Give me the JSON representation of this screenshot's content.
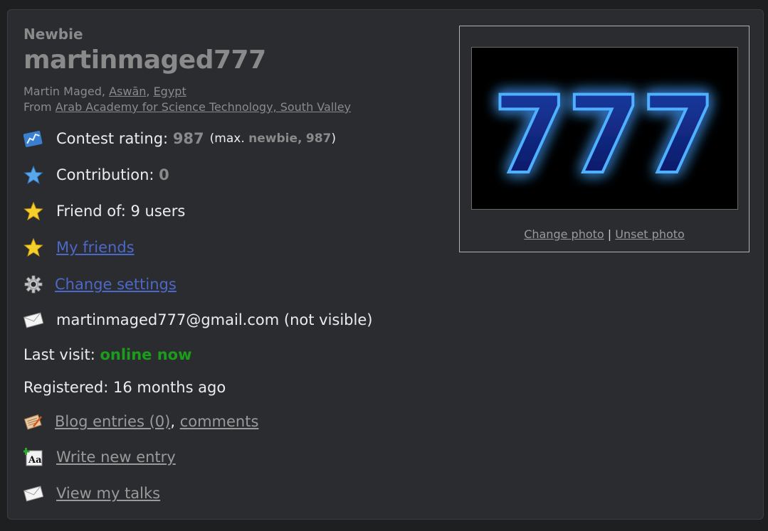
{
  "profile": {
    "rank": "Newbie",
    "handle": "martinmaged777",
    "name": "Martin Maged",
    "city": "Aswān",
    "country": "Egypt",
    "from_label": "From",
    "organization": "Arab Academy for Science Technology, South Valley"
  },
  "stats": {
    "rating_label": "Contest rating:",
    "rating_value": "987",
    "rating_max_prefix": "(max.",
    "rating_max_rank": "newbie,",
    "rating_max_value": "987",
    "rating_max_suffix": ")",
    "contribution_label": "Contribution:",
    "contribution_value": "0",
    "friend_of_label": "Friend of:",
    "friend_of_value": "9 users"
  },
  "links": {
    "my_friends": "My friends",
    "change_settings": "Change settings",
    "blog_entries": "Blog entries (0)",
    "comma": ",",
    "comments": "comments",
    "write_new_entry": "Write new entry",
    "view_my_talks": "View my talks"
  },
  "email": {
    "address": "martinmaged777@gmail.com",
    "note": "(not visible)"
  },
  "visit": {
    "last_visit_label": "Last visit:",
    "last_visit_value": "online now",
    "registered_label": "Registered:",
    "registered_value": "16 months ago"
  },
  "photo": {
    "text": "777",
    "change_label": "Change photo",
    "separator": "|",
    "unset_label": "Unset photo"
  },
  "colors": {
    "background": "#2b2c30",
    "link_blue": "#4c68c8",
    "online_green": "#1b9d1b",
    "muted_grey": "#8a8a8a"
  }
}
